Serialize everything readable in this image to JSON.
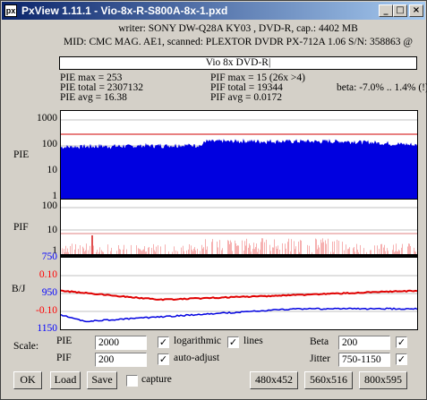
{
  "window": {
    "title": "PxView 1.11.1  -  Vio-8x-R-S800A-8x-1.pxd",
    "icon_text": "px",
    "controls": [
      "minimize-icon",
      "maximize-icon",
      "close-icon"
    ]
  },
  "header": {
    "writer_line": "writer: SONY DW-Q28A KY03 , DVD-R, cap.: 4402 MB",
    "media_line": "MID: CMC MAG. AE1, scanned: PLEXTOR DVDR PX-712A 1.06 S/N: 358863 @",
    "filename": "Vio 8x DVD-R|"
  },
  "stats": {
    "pie_max": "PIE max = 253",
    "pie_total": "PIE total = 2307132",
    "pie_avg": "PIE avg = 16.38",
    "pif_max": "PIF max = 15 (26x >4)",
    "pif_total": "PIF total = 19344",
    "pif_avg": "PIF avg = 0.0172",
    "beta": "beta: -7.0% .. 1.4% (!)"
  },
  "graphs": {
    "pie": {
      "label": "PIE",
      "ticks": [
        "1000",
        "100",
        "10",
        "1"
      ],
      "threshold": 280,
      "level_start": 85,
      "level_mid": 140,
      "level_end": 100
    },
    "pif": {
      "label": "PIF",
      "ticks": [
        "100",
        "10",
        "1"
      ],
      "threshold": 4
    },
    "bj": {
      "label": "B/J",
      "ticks": [
        "750",
        "0.10",
        "950",
        "-0.10",
        "1150"
      ],
      "tick_colors": [
        "#0000ff",
        "#ff0000",
        "#0000ff",
        "#ff0000",
        "#0000ff"
      ]
    }
  },
  "controls": {
    "scale_label": "Scale:",
    "pie_label": "PIE",
    "pie_value": "2000",
    "pif_label": "PIF",
    "pif_value": "200",
    "logarithmic_label": "logarithmic",
    "logarithmic_checked": true,
    "lines_label": "lines",
    "lines_checked": true,
    "auto_adjust_label": "auto-adjust",
    "auto_adjust_checked": true,
    "beta_label": "Beta",
    "beta_value": "200",
    "beta_checked": true,
    "jitter_label": "Jitter",
    "jitter_value": "750-1150",
    "jitter_checked": true,
    "capture_label": "capture",
    "capture_checked": false
  },
  "buttons": {
    "ok": "OK",
    "load": "Load",
    "save": "Save",
    "size1": "480x452",
    "size2": "560x516",
    "size3": "800x595"
  }
}
